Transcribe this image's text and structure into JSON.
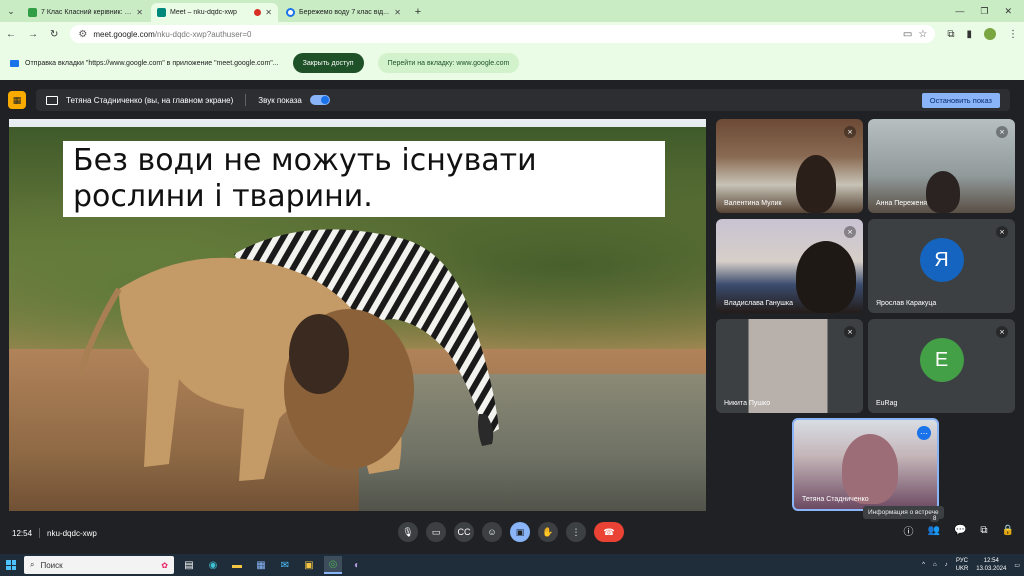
{
  "browser": {
    "tabs": [
      {
        "title": "7 Клас Класний керівник: Ста...",
        "favicon_color": "#2f9e44"
      },
      {
        "title": "Meet – nku-dqdc-xwp",
        "favicon_color": "#00897b"
      },
      {
        "title": "Бережемо воду 7 клас від...",
        "favicon_color": "#1a73e8"
      }
    ],
    "url_main": "meet.google.com",
    "url_path": "/nku-dqdc-xwp?authuser=0",
    "notification": {
      "text": "Отправка вкладки \"https://www.google.com\" в приложение \"meet.google.com\"...",
      "close_label": "Закрыть доступ",
      "goto_label": "Перейти на вкладку: www.google.com"
    }
  },
  "meet": {
    "presenter_text": "Тетяна Стадниченко (вы, на главном экране)",
    "audio_label": "Звук показа",
    "stop_label": "Остановить показ",
    "slide_caption": "Без води не можуть існувати рослини і тварини.",
    "participants": [
      {
        "name": "Валентина Мулик"
      },
      {
        "name": "Анна Переженя"
      },
      {
        "name": "Владислава Ганушка"
      },
      {
        "name": "Ярослав Каракуца",
        "initial": "Я",
        "color": "#1565c0"
      },
      {
        "name": "Никита Пушко"
      },
      {
        "name": "EuRag",
        "initial": "E",
        "color": "#43a047"
      }
    ],
    "self_name": "Тетяна Стадниченко",
    "tooltip": "Информация о встрече",
    "time": "12:54",
    "meeting_code": "nku-dqdc-xwp",
    "people_count": "8"
  },
  "taskbar": {
    "search_placeholder": "Поиск",
    "lang_top": "РУС",
    "lang_bottom": "UKR",
    "clock_time": "12:54",
    "clock_date": "13.03.2024"
  }
}
